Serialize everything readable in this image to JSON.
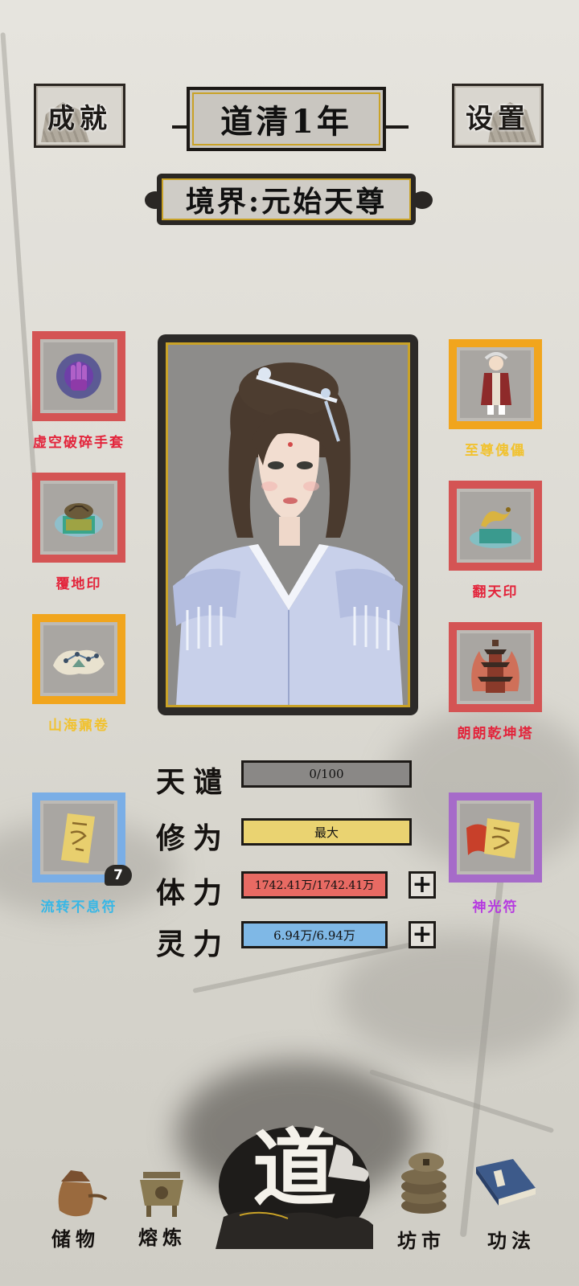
{
  "header": {
    "achievements_label": "成就",
    "settings_label": "设置",
    "year_title": "道清1年",
    "realm_title": "境界:元始天尊"
  },
  "equipment_left": [
    {
      "label": "虚空破碎手套",
      "icon": "purple-glove-icon",
      "color": "#d45454"
    },
    {
      "label": "覆地印",
      "icon": "turtle-seal-icon",
      "color": "#d45454"
    },
    {
      "label": "山海鼐卷",
      "icon": "scroll-map-icon",
      "color": "#f1a51d"
    },
    {
      "label": "流转不息符",
      "icon": "talisman-icon",
      "color": "#7aaee6",
      "count": "7"
    }
  ],
  "equipment_right": [
    {
      "label": "至尊傀儡",
      "icon": "puppet-icon",
      "color": "#f1a51d"
    },
    {
      "label": "翻天印",
      "icon": "dragon-seal-icon",
      "color": "#d45454"
    },
    {
      "label": "朗朗乾坤塔",
      "icon": "pagoda-icon",
      "color": "#d45454"
    },
    {
      "label": "神光符",
      "icon": "red-talisman-icon",
      "color": "#a66bc9"
    }
  ],
  "stats": {
    "tianqian": {
      "label": "天谴",
      "value": "0/100",
      "color": "#8a8886"
    },
    "xiuwei": {
      "label": "修为",
      "value": "最大",
      "color": "#ead371"
    },
    "tili": {
      "label": "体力",
      "value": "1742.41万/1742.41万",
      "color": "#e86a63"
    },
    "lingli": {
      "label": "灵力",
      "value": "6.94万/6.94万",
      "color": "#7fb8e6"
    },
    "plus_label": "+"
  },
  "nav": {
    "storage": "储物",
    "smelt": "熔炼",
    "dao": "道",
    "market": "坊市",
    "skills": "功法"
  }
}
